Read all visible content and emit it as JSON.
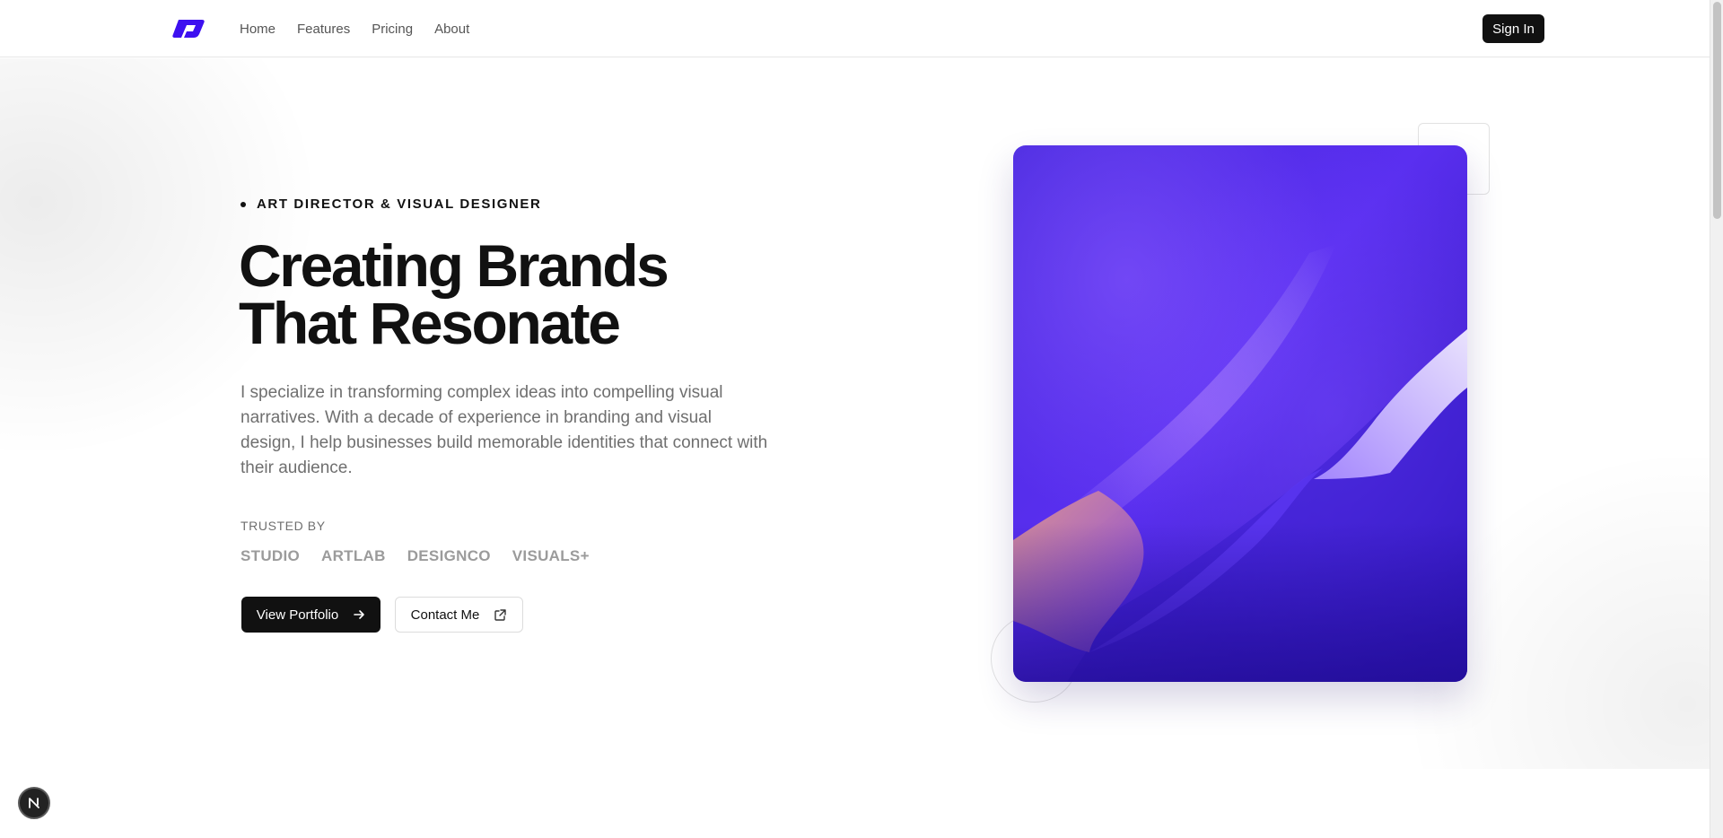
{
  "nav": {
    "logo_icon": "brand-logo-icon",
    "links": [
      {
        "label": "Home"
      },
      {
        "label": "Features"
      },
      {
        "label": "Pricing"
      },
      {
        "label": "About"
      }
    ],
    "signin_label": "Sign In"
  },
  "hero": {
    "eyebrow": "ART DIRECTOR & VISUAL DESIGNER",
    "title_lines": [
      "Creating Brands",
      "That Resonate"
    ],
    "description": "I specialize in transforming complex ideas into compelling visual narratives. With a decade of experience in branding and visual design, I help businesses build memorable identities that connect with their audience.",
    "trusted_label": "TRUSTED BY",
    "brands": [
      "STUDIO",
      "ARTLAB",
      "DESIGNCO",
      "VISUALS+"
    ],
    "primary_button": {
      "label": "View Portfolio",
      "icon": "arrow-right-icon"
    },
    "secondary_button": {
      "label": "Contact Me",
      "icon": "external-link-icon"
    }
  },
  "artwork": {
    "icon": "abstract-purple-wave-image"
  },
  "dev_badge": {
    "label": "N",
    "icon": "nextjs-icon"
  },
  "colors": {
    "accent": "#3d10f0",
    "primary_button": "#111111",
    "art_base": "#3b1fd0",
    "text_muted": "#6f6f6f"
  }
}
